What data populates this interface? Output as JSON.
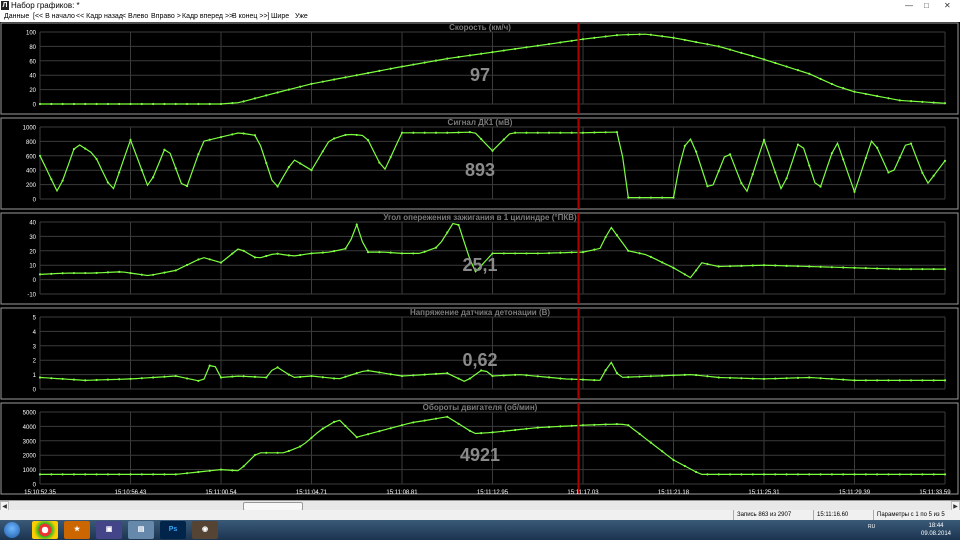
{
  "window": {
    "title": "Набор графиков: *",
    "controls": [
      "—",
      "□",
      "✕"
    ]
  },
  "menu": {
    "items": [
      "Данные",
      "[<< В начало",
      "<< Кадр назад",
      "< Влево",
      "Вправо >",
      "Кадр вперед >>",
      "В конец >>]",
      "Шире",
      "Уже"
    ]
  },
  "cursor_time": "15:11:17.03",
  "colors": {
    "trace": "#7dff3f",
    "grid": "#3b3b3b",
    "cursor": "#b00000",
    "title": "#7a7a7a",
    "value": "#8a8a8a",
    "axis_text": "#ffffff"
  },
  "time_axis": {
    "labels": [
      "15:10:52.35",
      "15:10:56.43",
      "15:11:00.54",
      "15:11:04.71",
      "15:11:08.81",
      "15:11:12.95",
      "15:11:17.03",
      "15:11:21.18",
      "15:11:25.31",
      "15:11:29.39",
      "15:11:33.59"
    ]
  },
  "panels": [
    {
      "id": "speed",
      "title": "Скорость  (км/ч)",
      "value": "97",
      "yticks": [
        "100",
        "80",
        "60",
        "40",
        "20",
        "0"
      ],
      "chart_data": {
        "type": "line",
        "ylim": [
          0,
          100
        ],
        "x_range": [
          0,
          1
        ],
        "x": [
          0,
          0.2,
          0.22,
          0.25,
          0.3,
          0.35,
          0.4,
          0.45,
          0.5,
          0.55,
          0.6,
          0.64,
          0.67,
          0.7,
          0.75,
          0.8,
          0.85,
          0.88,
          0.9,
          0.95,
          1.0
        ],
        "y": [
          0,
          0,
          2,
          12,
          28,
          40,
          52,
          63,
          72,
          81,
          90,
          96,
          97,
          92,
          80,
          62,
          42,
          25,
          17,
          5,
          1
        ]
      }
    },
    {
      "id": "o2",
      "title": "Сигнал ДК1  (мВ)",
      "value": "893",
      "yticks": [
        "1000",
        "800",
        "600",
        "400",
        "200",
        "0"
      ],
      "chart_data": {
        "type": "line",
        "ylim": [
          0,
          1000
        ],
        "x_range": [
          0,
          1
        ],
        "x": [
          0,
          0.02,
          0.04,
          0.06,
          0.08,
          0.1,
          0.12,
          0.14,
          0.16,
          0.18,
          0.2,
          0.22,
          0.24,
          0.26,
          0.28,
          0.3,
          0.32,
          0.34,
          0.36,
          0.38,
          0.4,
          0.45,
          0.48,
          0.5,
          0.52,
          0.6,
          0.64,
          0.65,
          0.66,
          0.7,
          0.71,
          0.72,
          0.74,
          0.76,
          0.78,
          0.8,
          0.82,
          0.84,
          0.86,
          0.88,
          0.9,
          0.92,
          0.94,
          0.96,
          0.98,
          1.0
        ],
        "y": [
          600,
          80,
          780,
          620,
          100,
          820,
          150,
          760,
          90,
          800,
          860,
          920,
          880,
          120,
          550,
          400,
          820,
          900,
          880,
          380,
          920,
          920,
          930,
          670,
          920,
          920,
          930,
          20,
          20,
          20,
          700,
          850,
          80,
          700,
          60,
          820,
          100,
          850,
          80,
          820,
          100,
          850,
          300,
          850,
          200,
          530
        ]
      }
    },
    {
      "id": "ign",
      "title": "Угол опережения зажигания в 1 цилиндре  (°ПКВ)",
      "value": "25,1",
      "yticks": [
        "40",
        "30",
        "20",
        "10",
        "0",
        "-10"
      ],
      "chart_data": {
        "type": "line",
        "ylim": [
          -10,
          45
        ],
        "x_range": [
          0,
          1
        ],
        "x": [
          0,
          0.03,
          0.06,
          0.09,
          0.12,
          0.15,
          0.18,
          0.2,
          0.22,
          0.24,
          0.26,
          0.28,
          0.3,
          0.32,
          0.34,
          0.35,
          0.36,
          0.38,
          0.4,
          0.42,
          0.44,
          0.46,
          0.48,
          0.5,
          0.55,
          0.6,
          0.62,
          0.63,
          0.65,
          0.67,
          0.7,
          0.72,
          0.73,
          0.75,
          0.8,
          0.85,
          0.9,
          0.95,
          1.0
        ],
        "y": [
          5,
          6,
          6,
          7,
          4,
          8,
          18,
          14,
          25,
          17,
          21,
          19,
          21,
          22,
          25,
          43,
          22,
          22,
          21,
          21,
          26,
          48,
          6,
          21,
          21,
          22,
          25,
          42,
          23,
          20,
          10,
          2,
          14,
          11,
          12,
          11,
          10,
          9,
          9
        ]
      }
    },
    {
      "id": "knock",
      "title": "Напряжение датчика детонации  (В)",
      "value": "0,62",
      "yticks": [
        "5",
        "4",
        "3",
        "2",
        "1",
        "0"
      ],
      "chart_data": {
        "type": "line",
        "ylim": [
          0,
          5
        ],
        "x_range": [
          0,
          1
        ],
        "x": [
          0,
          0.05,
          0.1,
          0.15,
          0.18,
          0.19,
          0.2,
          0.22,
          0.25,
          0.26,
          0.28,
          0.3,
          0.33,
          0.36,
          0.4,
          0.45,
          0.47,
          0.49,
          0.5,
          0.53,
          0.58,
          0.62,
          0.63,
          0.64,
          0.68,
          0.72,
          0.75,
          0.8,
          0.85,
          0.9,
          0.95,
          1.0
        ],
        "y": [
          0.8,
          0.6,
          0.7,
          0.9,
          0.5,
          2.0,
          0.8,
          0.9,
          0.8,
          1.6,
          0.8,
          0.9,
          0.7,
          1.3,
          0.9,
          1.1,
          0.5,
          1.4,
          0.9,
          1.0,
          0.7,
          0.6,
          2.0,
          0.8,
          0.9,
          1.0,
          0.8,
          0.7,
          0.8,
          0.6,
          0.6,
          0.6
        ]
      }
    },
    {
      "id": "rpm",
      "title": "Обороты двигателя  (об/мин)",
      "value": "4921",
      "yticks": [
        "5000",
        "4000",
        "3000",
        "2000",
        "1000",
        "0"
      ],
      "chart_data": {
        "type": "line",
        "ylim": [
          0,
          6000
        ],
        "x_range": [
          0,
          1
        ],
        "x": [
          0,
          0.05,
          0.1,
          0.15,
          0.2,
          0.22,
          0.24,
          0.25,
          0.27,
          0.29,
          0.31,
          0.33,
          0.35,
          0.37,
          0.39,
          0.41,
          0.45,
          0.48,
          0.5,
          0.55,
          0.6,
          0.64,
          0.65,
          0.7,
          0.73,
          0.8,
          0.9,
          1.0
        ],
        "y": [
          800,
          800,
          800,
          800,
          1200,
          1100,
          2600,
          2600,
          2600,
          3200,
          4500,
          5400,
          3900,
          4300,
          4700,
          5100,
          5600,
          4200,
          4300,
          4700,
          4900,
          5000,
          4900,
          2000,
          800,
          800,
          800,
          800
        ]
      }
    }
  ],
  "status": {
    "record": "Запись 863 из 2907",
    "time": "15:11:16.60",
    "params": "Параметры с 1 по 5 из 5"
  },
  "taskbar": {
    "clock_time": "18:44",
    "clock_date": "09.08.2014",
    "lang": "RU",
    "apps": [
      "chrome",
      "app",
      "floppy",
      "files",
      "Ps",
      "obd"
    ]
  }
}
